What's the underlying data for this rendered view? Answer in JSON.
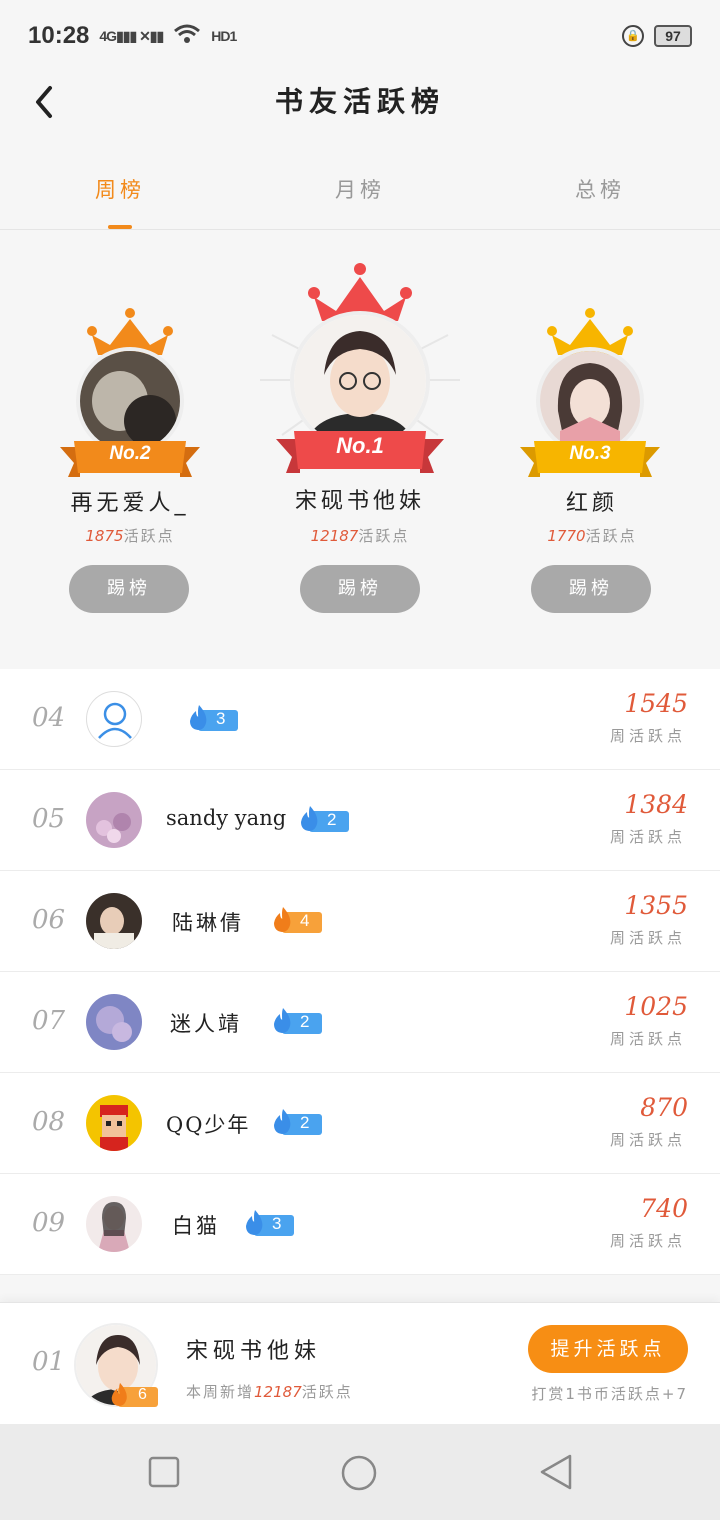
{
  "status": {
    "time": "10:28",
    "signal": "4G",
    "hd": "HD1",
    "battery": "97"
  },
  "header": {
    "title": "书友活跃榜"
  },
  "tabs": [
    {
      "label": "周榜",
      "active": true
    },
    {
      "label": "月榜",
      "active": false
    },
    {
      "label": "总榜",
      "active": false
    }
  ],
  "podium": {
    "points_unit": "活跃点",
    "kick_label": "踢榜",
    "first": {
      "badge": "No.1",
      "name": "宋砚书他妹",
      "points": "12187"
    },
    "second": {
      "badge": "No.2",
      "name": "再无爱人_",
      "points": "1875"
    },
    "third": {
      "badge": "No.3",
      "name": "红颜",
      "points": "1770"
    }
  },
  "list": {
    "unit": "周活跃点",
    "rows": [
      {
        "rank": "04",
        "name": "",
        "level": "3",
        "level_color": "blue",
        "score": "1545"
      },
      {
        "rank": "05",
        "name": "sandy yang",
        "level": "2",
        "level_color": "blue",
        "score": "1384"
      },
      {
        "rank": "06",
        "name": "陆琳倩",
        "level": "4",
        "level_color": "orange",
        "score": "1355"
      },
      {
        "rank": "07",
        "name": "迷人靖",
        "level": "2",
        "level_color": "blue",
        "score": "1025"
      },
      {
        "rank": "08",
        "name": "QQ少年",
        "level": "2",
        "level_color": "blue",
        "score": "870"
      },
      {
        "rank": "09",
        "name": "白猫",
        "level": "3",
        "level_color": "blue",
        "score": "740"
      }
    ]
  },
  "me": {
    "rank": "01",
    "name": "宋砚书他妹",
    "level": "6",
    "sub_prefix": "本周新增",
    "sub_points": "12187",
    "sub_suffix": "活跃点",
    "boost_label": "提升活跃点",
    "tip": "打赏1书币活跃点+7"
  },
  "colors": {
    "accent": "#f28a1b",
    "score": "#e05a3a",
    "blue_level": "#4aa3ef",
    "orange_level": "#f7a13a"
  }
}
